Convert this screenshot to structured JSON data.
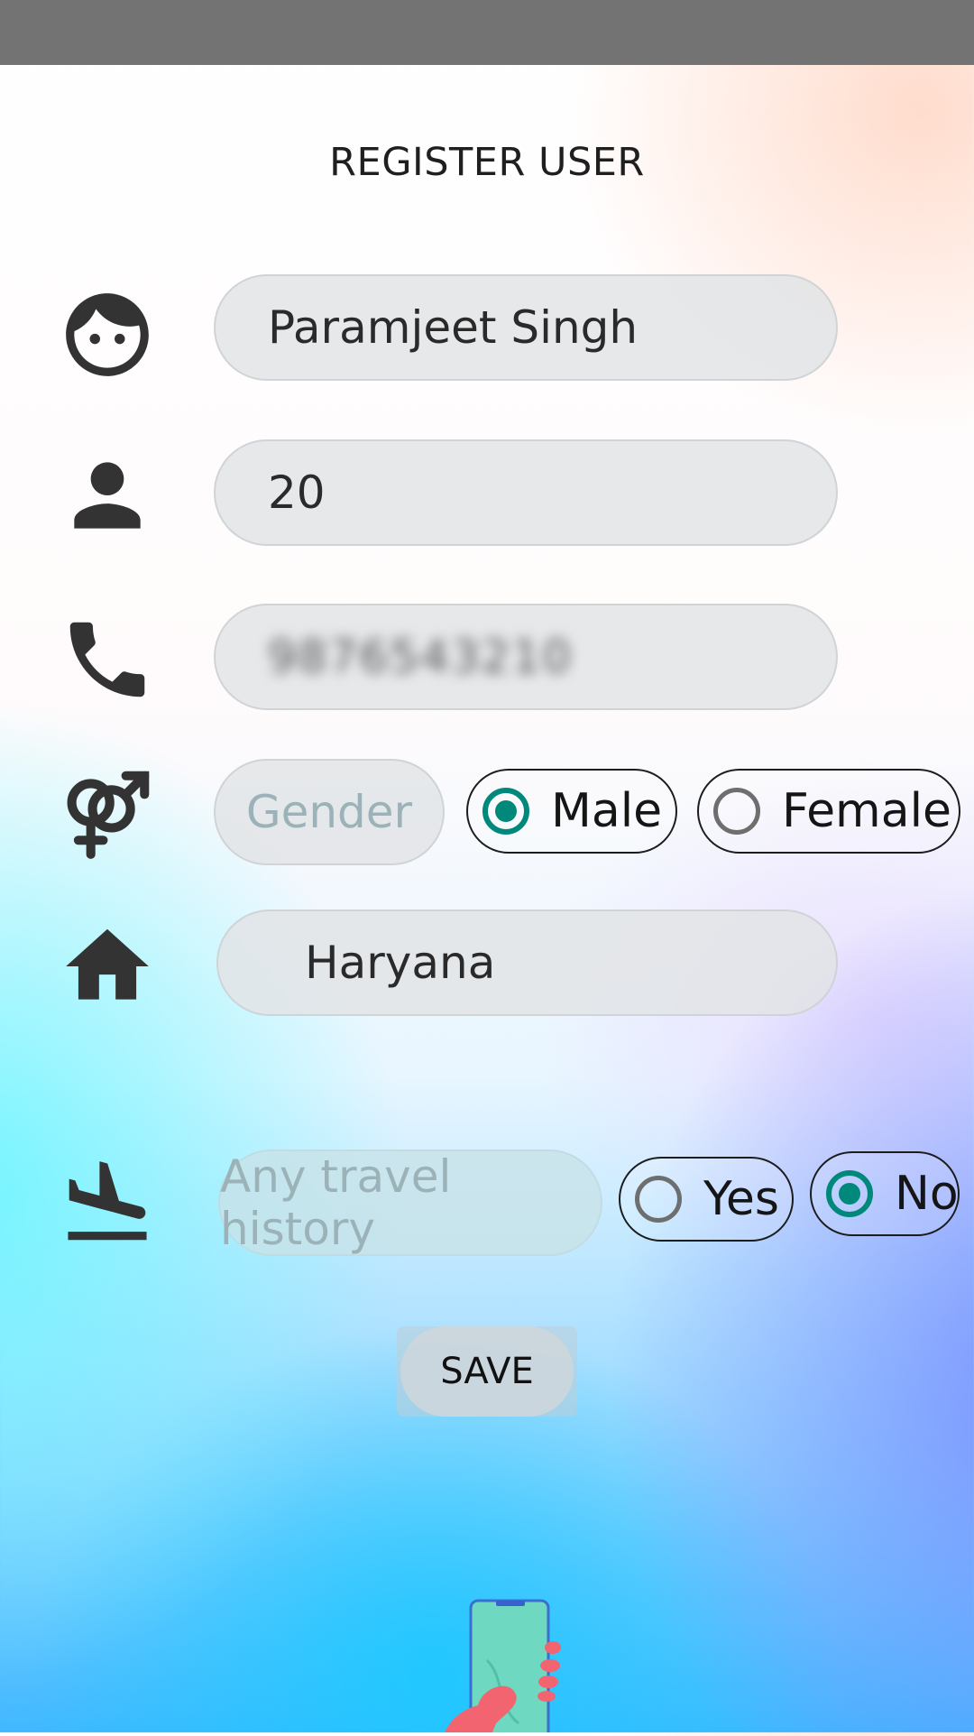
{
  "title": "REGISTER USER",
  "fields": {
    "name": {
      "value": "Paramjeet Singh"
    },
    "age": {
      "value": "20"
    },
    "phone": {
      "value": "9876543210"
    },
    "gender": {
      "label": "Gender",
      "options": [
        {
          "label": "Male",
          "selected": true
        },
        {
          "label": "Female",
          "selected": false
        }
      ]
    },
    "state": {
      "value": "Haryana"
    },
    "travel": {
      "label": "Any travel history",
      "options": [
        {
          "label": "Yes",
          "selected": false
        },
        {
          "label": "No",
          "selected": true
        }
      ]
    }
  },
  "save_label": "SAVE",
  "icons": {
    "name": "face-icon",
    "age": "person-icon",
    "phone": "phone-icon",
    "gender": "gender-icon",
    "state": "home-icon",
    "travel": "flight-land-icon"
  },
  "colors": {
    "accent": "#00897b",
    "status_bar": "#737373",
    "icon": "#333333"
  }
}
